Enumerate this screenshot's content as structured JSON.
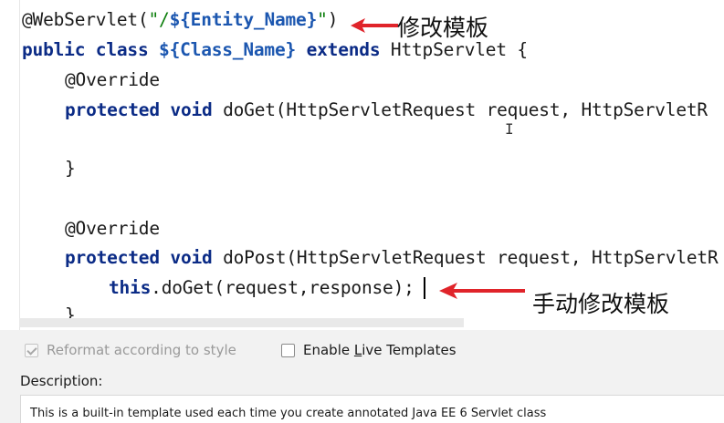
{
  "editor": {
    "code": {
      "l1_at": "@WebServlet(",
      "l1_str_open": "\"/",
      "l1_var": "${Entity_Name}",
      "l1_str_close": "\"",
      "l1_close": ")",
      "l2_kw1": "public class ",
      "l2_var": "${Class_Name}",
      "l2_kw2": " extends",
      "l2_rest": " HttpServlet {",
      "l3": "@Override",
      "l4_kw": "protected void",
      "l4_rest": " doGet(HttpServletRequest request, HttpServletR",
      "l5": "}",
      "l6": "@Override",
      "l7_kw": "protected void",
      "l7_rest": " doPost(HttpServletRequest request, HttpServletR",
      "l8_kw": "this",
      "l8_rest": ".doGet(request,response);",
      "l9": "}"
    },
    "annotations": {
      "top": "修改模板",
      "bottom": "手动修改模板"
    }
  },
  "options": {
    "reformat_label": "Reformat according to style",
    "reformat_checked": true,
    "reformat_enabled": false,
    "live_templates_pre": "Enable ",
    "live_templates_u": "L",
    "live_templates_post": "ive Templates",
    "live_templates_checked": false
  },
  "description": {
    "label": "Description:",
    "text": "This is a built-in template used each time you create annotated Java EE 6 Servlet class"
  },
  "colors": {
    "keyword": "#0b2b86",
    "template_variable": "#1c57b0",
    "string": "#0a7d0a",
    "annotation_arrow": "#e0242a"
  }
}
